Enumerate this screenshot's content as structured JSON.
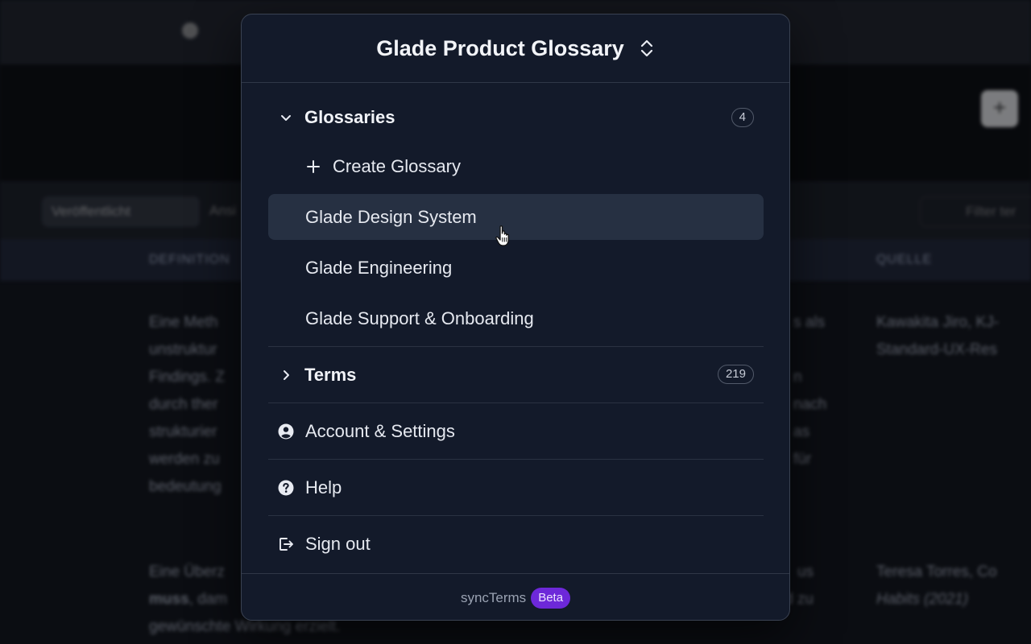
{
  "background": {
    "filter_chip": "Veröffentlicht",
    "filter_next": "Ansi",
    "search_placeholder": "Filter ter",
    "col_definition": "DEFINITION",
    "col_source": "QUELLE",
    "def1": "Eine Meth\nunstruktur\nFindings. Z\ndurch ther\nstrukturier\nwerden zu\nbedeutung",
    "mid1": "s als\n\nn\nnach\nas\nfür",
    "src1": "Kawakita Jiro, KJ-\nStandard-UX-Res",
    "def2_a": "Eine Überz",
    "def2_b": "muss",
    "def2_c": ", dam",
    "def2_d": "gewünschte Wirkung erzielt.",
    "mid2": "us\nextrahieren und nach Risikograd zu",
    "src2_a": "Teresa Torres, Co",
    "src2_b": "Habits (2021)"
  },
  "panel": {
    "title": "Glade Product Glossary",
    "glossaries": {
      "label": "Glossaries",
      "count": "4",
      "create_label": "Create Glossary",
      "items": [
        {
          "label": "Glade Design System"
        },
        {
          "label": "Glade Engineering"
        },
        {
          "label": "Glade Support & Onboarding"
        }
      ]
    },
    "terms": {
      "label": "Terms",
      "count": "219"
    },
    "actions": {
      "account": "Account & Settings",
      "help": "Help",
      "signout": "Sign out"
    },
    "footer": {
      "brand": "syncTerms",
      "badge": "Beta"
    }
  },
  "colors": {
    "panel_bg": "#131a2a",
    "hover_bg": "#263042",
    "beta_badge": "#6d28d9"
  }
}
